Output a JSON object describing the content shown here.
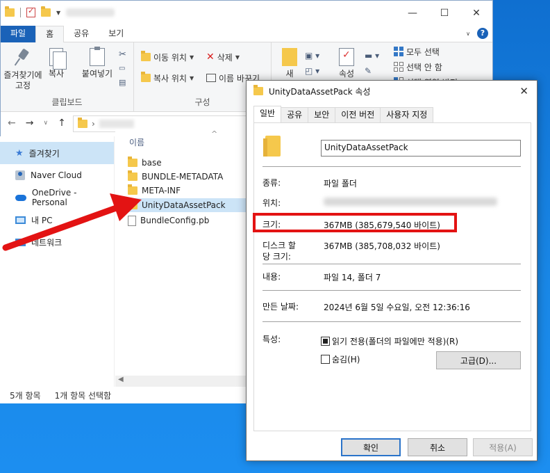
{
  "explorer": {
    "window_controls": {
      "minimize": "—",
      "maximize": "☐",
      "close": "✕"
    },
    "tabs": [
      "파일",
      "홈",
      "공유",
      "보기"
    ],
    "active_tab": "홈",
    "ribbon": {
      "pin_label": "즐겨찾기에 고정",
      "copy_label": "복사",
      "paste_label": "붙여넣기",
      "clipboard_group": "클립보드",
      "move_to": "이동 위치",
      "copy_to": "복사 위치",
      "delete": "삭제",
      "rename": "이름 바꾸기",
      "organize_group": "구성",
      "new_label": "새",
      "properties_label": "속성",
      "select_all": "모두 선택",
      "select_none": "선택 안 함",
      "invert_select": "선택 영역 반전"
    },
    "sidebar": [
      {
        "label": "즐겨찾기",
        "icon": "star-icon",
        "selected": true
      },
      {
        "label": "Naver Cloud",
        "icon": "naver-cloud-icon"
      },
      {
        "label": "OneDrive - Personal",
        "icon": "onedrive-icon"
      },
      {
        "label": "내 PC",
        "icon": "pc-icon"
      },
      {
        "label": "네트워크",
        "icon": "network-icon"
      }
    ],
    "column_header": "이름",
    "files": [
      {
        "name": "base",
        "type": "folder"
      },
      {
        "name": "BUNDLE-METADATA",
        "type": "folder"
      },
      {
        "name": "META-INF",
        "type": "folder"
      },
      {
        "name": "UnityDataAssetPack",
        "type": "folder",
        "selected": true
      },
      {
        "name": "BundleConfig.pb",
        "type": "file"
      }
    ],
    "status": {
      "count": "5개 항목",
      "selected": "1개 항목 선택함"
    }
  },
  "dialog": {
    "title": "UnityDataAssetPack 속성",
    "tabs": [
      "일반",
      "공유",
      "보안",
      "이전 버전",
      "사용자 지정"
    ],
    "active_tab": "일반",
    "name_value": "UnityDataAssetPack",
    "rows": {
      "type_label": "종류:",
      "type_value": "파일 폴더",
      "location_label": "위치:",
      "size_label": "크기:",
      "size_value": "367MB (385,679,540 바이트)",
      "disk_label": "디스크 할\n당 크기:",
      "disk_value": "367MB (385,708,032 바이트)",
      "contents_label": "내용:",
      "contents_value": "파일 14, 폴더 7",
      "created_label": "만든 날짜:",
      "created_value": "2024년 6월 5일 수요일, 오전 12:36:16",
      "attributes_label": "특성:",
      "readonly_label": "읽기 전용(폴더의 파일에만 적용)(R)",
      "hidden_label": "숨김(H)",
      "advanced_button": "고급(D)..."
    },
    "buttons": {
      "ok": "확인",
      "cancel": "취소",
      "apply": "적용(A)"
    }
  },
  "annotation_color": "#e31313"
}
